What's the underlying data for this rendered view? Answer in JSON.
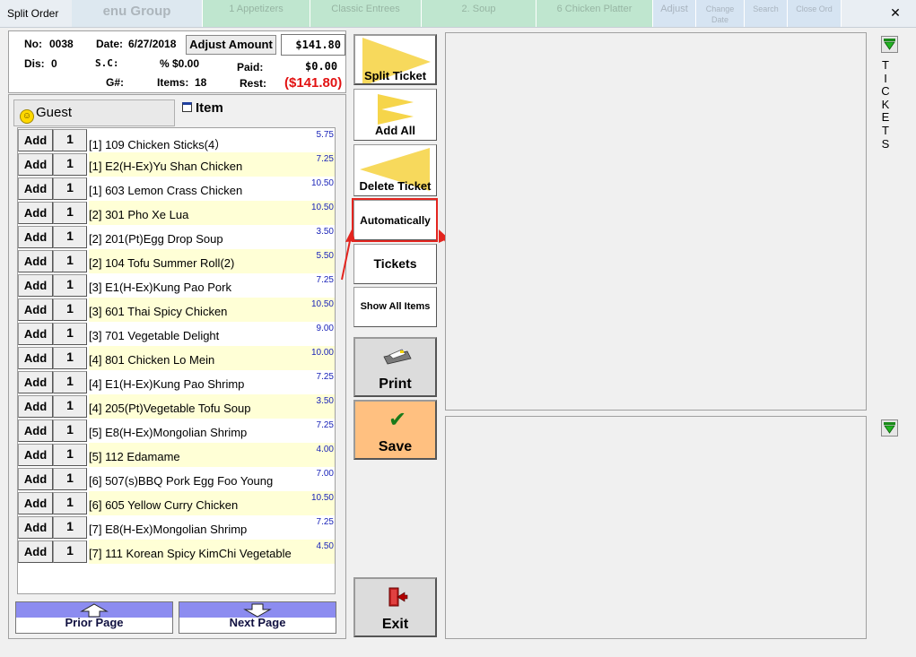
{
  "window": {
    "title": "Split Order",
    "close_glyph": "✕"
  },
  "background_tabs": [
    "enu Group",
    "1 Appetizers",
    "Classic Entrees",
    "2. Soup",
    "6 Chicken Platter",
    "Adjust",
    "Change Date",
    "Search",
    "Close Ord"
  ],
  "header": {
    "no_label": "No:",
    "no_value": "0038",
    "date_label": "Date:",
    "date_value": "6/27/2018",
    "adjust_label": "Adjust Amount",
    "total": "$141.80",
    "dis_label": "Dis:",
    "dis_value": "0",
    "sc_label": "S.C:",
    "sc_pct_label": "%",
    "sc_value": "$0.00",
    "paid_label": "Paid:",
    "paid_value": "$0.00",
    "g_label": "G#:",
    "items_label": "Items:",
    "items_value": "18",
    "rest_label": "Rest:",
    "rest_value": "($141.80)"
  },
  "tabs": {
    "guest": "Guest",
    "item": "Item"
  },
  "items": [
    {
      "add": "Add",
      "qty": "1",
      "name": "[1] 109 Chicken Sticks(4）",
      "price": "5.75"
    },
    {
      "add": "Add",
      "qty": "1",
      "name": "[1] E2(H-Ex)Yu Shan Chicken",
      "price": "7.25"
    },
    {
      "add": "Add",
      "qty": "1",
      "name": "[1] 603 Lemon Crass Chicken",
      "price": "10.50"
    },
    {
      "add": "Add",
      "qty": "1",
      "name": "[2] 301 Pho Xe Lua",
      "price": "10.50"
    },
    {
      "add": "Add",
      "qty": "1",
      "name": "[2] 201(Pt)Egg Drop Soup",
      "price": "3.50"
    },
    {
      "add": "Add",
      "qty": "1",
      "name": "[2] 104 Tofu Summer Roll(2)",
      "price": "5.50"
    },
    {
      "add": "Add",
      "qty": "1",
      "name": "[3] E1(H-Ex)Kung Pao Pork",
      "price": "7.25"
    },
    {
      "add": "Add",
      "qty": "1",
      "name": "[3] 601 Thai Spicy Chicken",
      "price": "10.50"
    },
    {
      "add": "Add",
      "qty": "1",
      "name": "[3] 701 Vegetable Delight",
      "price": "9.00"
    },
    {
      "add": "Add",
      "qty": "1",
      "name": "[4] 801 Chicken Lo Mein",
      "price": "10.00"
    },
    {
      "add": "Add",
      "qty": "1",
      "name": "[4] E1(H-Ex)Kung Pao Shrimp",
      "price": "7.25"
    },
    {
      "add": "Add",
      "qty": "1",
      "name": "[4] 205(Pt)Vegetable Tofu Soup",
      "price": "3.50"
    },
    {
      "add": "Add",
      "qty": "1",
      "name": "[5] E8(H-Ex)Mongolian Shrimp",
      "price": "7.25"
    },
    {
      "add": "Add",
      "qty": "1",
      "name": "[5] 112 Edamame",
      "price": "4.00"
    },
    {
      "add": "Add",
      "qty": "1",
      "name": "[6] 507(s)BBQ Pork Egg Foo Young",
      "price": "7.00"
    },
    {
      "add": "Add",
      "qty": "1",
      "name": "[6] 605 Yellow Curry Chicken",
      "price": "10.50"
    },
    {
      "add": "Add",
      "qty": "1",
      "name": "[7] E8(H-Ex)Mongolian Shrimp",
      "price": "7.25"
    },
    {
      "add": "Add",
      "qty": "1",
      "name": "[7] 111 Korean Spicy KimChi Vegetable",
      "price": "4.50"
    }
  ],
  "paging": {
    "prior": "Prior Page",
    "next": "Next Page"
  },
  "buttons": {
    "split_ticket": "Split Ticket",
    "add_all": "Add All",
    "delete_ticket": "Delete Ticket",
    "automatically": "Automatically",
    "tickets": "Tickets",
    "show_all_items": "Show All Items",
    "print": "Print",
    "save": "Save",
    "exit": "Exit"
  },
  "right": {
    "tickets_vertical": [
      "T",
      "I",
      "C",
      "K",
      "E",
      "T",
      "S"
    ]
  },
  "colors": {
    "row_highlight": "#ffffd6",
    "price_text": "#1a24b8",
    "rest_text": "#e21212",
    "save_bg": "#ffc080",
    "print_bg": "#dcdcdc",
    "exit_bg": "#dcdcdc",
    "page_band": "#8c8cf0",
    "callout": "#e3251f"
  }
}
